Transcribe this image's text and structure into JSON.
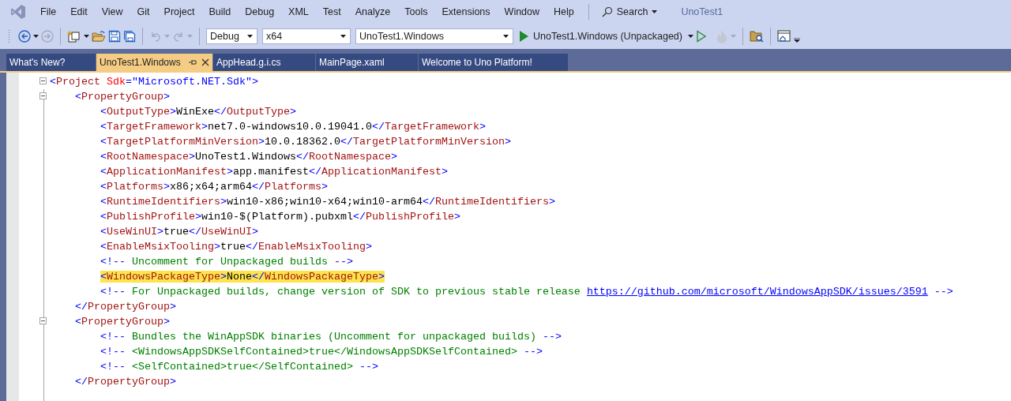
{
  "menu": {
    "items": [
      "File",
      "Edit",
      "View",
      "Git",
      "Project",
      "Build",
      "Debug",
      "XML",
      "Test",
      "Analyze",
      "Tools",
      "Extensions",
      "Window",
      "Help"
    ],
    "search": "Search",
    "solution_title": "UnoTest1"
  },
  "toolbar": {
    "configuration": "Debug",
    "platform": "x64",
    "startup_project": "UnoTest1.Windows",
    "run_target": "UnoTest1.Windows (Unpackaged)"
  },
  "tabs": [
    {
      "label": "What's New?",
      "selected": false
    },
    {
      "label": "UnoTest1.Windows",
      "selected": true
    },
    {
      "label": "AppHead.g.i.cs",
      "selected": false
    },
    {
      "label": "MainPage.xaml",
      "selected": false
    },
    {
      "label": "Welcome to Uno Platform!",
      "selected": false
    }
  ],
  "editor": {
    "lines": [
      {
        "highlighted": false,
        "tokens": [
          {
            "kind": "punct",
            "text": "<"
          },
          {
            "kind": "tag",
            "text": "Project"
          },
          {
            "kind": "attr",
            "text": " Sdk"
          },
          {
            "kind": "punct",
            "text": "="
          },
          {
            "kind": "value",
            "text": "\"Microsoft.NET.Sdk\""
          },
          {
            "kind": "punct",
            "text": ">"
          }
        ],
        "children": [
          {
            "highlighted": false,
            "tokens": [
              {
                "kind": "punct",
                "text": "<"
              },
              {
                "kind": "tag",
                "text": "PropertyGroup"
              },
              {
                "kind": "punct",
                "text": ">"
              }
            ],
            "children": [
              {
                "highlighted": false,
                "tokens": [
                  {
                    "kind": "punct",
                    "text": "<"
                  },
                  {
                    "kind": "tag",
                    "text": "OutputType"
                  },
                  {
                    "kind": "punct",
                    "text": ">"
                  },
                  {
                    "kind": "text",
                    "text": "WinExe"
                  },
                  {
                    "kind": "punct",
                    "text": "</"
                  },
                  {
                    "kind": "tag",
                    "text": "OutputType"
                  },
                  {
                    "kind": "punct",
                    "text": ">"
                  }
                ]
              },
              {
                "highlighted": false,
                "tokens": [
                  {
                    "kind": "punct",
                    "text": "<"
                  },
                  {
                    "kind": "tag",
                    "text": "TargetFramework"
                  },
                  {
                    "kind": "punct",
                    "text": ">"
                  },
                  {
                    "kind": "text",
                    "text": "net7.0-windows10.0.19041.0"
                  },
                  {
                    "kind": "punct",
                    "text": "</"
                  },
                  {
                    "kind": "tag",
                    "text": "TargetFramework"
                  },
                  {
                    "kind": "punct",
                    "text": ">"
                  }
                ]
              },
              {
                "highlighted": false,
                "tokens": [
                  {
                    "kind": "punct",
                    "text": "<"
                  },
                  {
                    "kind": "tag",
                    "text": "TargetPlatformMinVersion"
                  },
                  {
                    "kind": "punct",
                    "text": ">"
                  },
                  {
                    "kind": "text",
                    "text": "10.0.18362.0"
                  },
                  {
                    "kind": "punct",
                    "text": "</"
                  },
                  {
                    "kind": "tag",
                    "text": "TargetPlatformMinVersion"
                  },
                  {
                    "kind": "punct",
                    "text": ">"
                  }
                ]
              },
              {
                "highlighted": false,
                "tokens": [
                  {
                    "kind": "punct",
                    "text": "<"
                  },
                  {
                    "kind": "tag",
                    "text": "RootNamespace"
                  },
                  {
                    "kind": "punct",
                    "text": ">"
                  },
                  {
                    "kind": "text",
                    "text": "UnoTest1.Windows"
                  },
                  {
                    "kind": "punct",
                    "text": "</"
                  },
                  {
                    "kind": "tag",
                    "text": "RootNamespace"
                  },
                  {
                    "kind": "punct",
                    "text": ">"
                  }
                ]
              },
              {
                "highlighted": false,
                "tokens": [
                  {
                    "kind": "punct",
                    "text": "<"
                  },
                  {
                    "kind": "tag",
                    "text": "ApplicationManifest"
                  },
                  {
                    "kind": "punct",
                    "text": ">"
                  },
                  {
                    "kind": "text",
                    "text": "app.manifest"
                  },
                  {
                    "kind": "punct",
                    "text": "</"
                  },
                  {
                    "kind": "tag",
                    "text": "ApplicationManifest"
                  },
                  {
                    "kind": "punct",
                    "text": ">"
                  }
                ]
              },
              {
                "highlighted": false,
                "tokens": [
                  {
                    "kind": "punct",
                    "text": "<"
                  },
                  {
                    "kind": "tag",
                    "text": "Platforms"
                  },
                  {
                    "kind": "punct",
                    "text": ">"
                  },
                  {
                    "kind": "text",
                    "text": "x86;x64;arm64"
                  },
                  {
                    "kind": "punct",
                    "text": "</"
                  },
                  {
                    "kind": "tag",
                    "text": "Platforms"
                  },
                  {
                    "kind": "punct",
                    "text": ">"
                  }
                ]
              },
              {
                "highlighted": false,
                "tokens": [
                  {
                    "kind": "punct",
                    "text": "<"
                  },
                  {
                    "kind": "tag",
                    "text": "RuntimeIdentifiers"
                  },
                  {
                    "kind": "punct",
                    "text": ">"
                  },
                  {
                    "kind": "text",
                    "text": "win10-x86;win10-x64;win10-arm64"
                  },
                  {
                    "kind": "punct",
                    "text": "</"
                  },
                  {
                    "kind": "tag",
                    "text": "RuntimeIdentifiers"
                  },
                  {
                    "kind": "punct",
                    "text": ">"
                  }
                ]
              },
              {
                "highlighted": false,
                "tokens": [
                  {
                    "kind": "punct",
                    "text": "<"
                  },
                  {
                    "kind": "tag",
                    "text": "PublishProfile"
                  },
                  {
                    "kind": "punct",
                    "text": ">"
                  },
                  {
                    "kind": "text",
                    "text": "win10-$(Platform).pubxml"
                  },
                  {
                    "kind": "punct",
                    "text": "</"
                  },
                  {
                    "kind": "tag",
                    "text": "PublishProfile"
                  },
                  {
                    "kind": "punct",
                    "text": ">"
                  }
                ]
              },
              {
                "highlighted": false,
                "tokens": [
                  {
                    "kind": "punct",
                    "text": "<"
                  },
                  {
                    "kind": "tag",
                    "text": "UseWinUI"
                  },
                  {
                    "kind": "punct",
                    "text": ">"
                  },
                  {
                    "kind": "text",
                    "text": "true"
                  },
                  {
                    "kind": "punct",
                    "text": "</"
                  },
                  {
                    "kind": "tag",
                    "text": "UseWinUI"
                  },
                  {
                    "kind": "punct",
                    "text": ">"
                  }
                ]
              },
              {
                "highlighted": false,
                "tokens": [
                  {
                    "kind": "punct",
                    "text": "<"
                  },
                  {
                    "kind": "tag",
                    "text": "EnableMsixTooling"
                  },
                  {
                    "kind": "punct",
                    "text": ">"
                  },
                  {
                    "kind": "text",
                    "text": "true"
                  },
                  {
                    "kind": "punct",
                    "text": "</"
                  },
                  {
                    "kind": "tag",
                    "text": "EnableMsixTooling"
                  },
                  {
                    "kind": "punct",
                    "text": ">"
                  }
                ]
              },
              {
                "highlighted": false,
                "tokens": [
                  {
                    "kind": "punct",
                    "text": "<!--"
                  },
                  {
                    "kind": "comment",
                    "text": " Uncomment for Unpackaged builds "
                  },
                  {
                    "kind": "punct",
                    "text": "-->"
                  }
                ]
              },
              {
                "highlighted": true,
                "tokens": [
                  {
                    "kind": "punct",
                    "text": "<"
                  },
                  {
                    "kind": "tag",
                    "text": "WindowsPackageType"
                  },
                  {
                    "kind": "punct",
                    "text": ">"
                  },
                  {
                    "kind": "text",
                    "text": "None"
                  },
                  {
                    "kind": "punct",
                    "text": "</"
                  },
                  {
                    "kind": "tag",
                    "text": "WindowsPackageType"
                  },
                  {
                    "kind": "punct",
                    "text": ">"
                  }
                ]
              },
              {
                "highlighted": false,
                "tokens": [
                  {
                    "kind": "punct",
                    "text": "<!--"
                  },
                  {
                    "kind": "comment",
                    "text": " For Unpackaged builds, change version of SDK to previous stable release "
                  },
                  {
                    "kind": "link",
                    "text": "https://github.com/microsoft/WindowsAppSDK/issues/3591"
                  },
                  {
                    "kind": "punct",
                    "text": " -->"
                  }
                ]
              }
            ]
          },
          {
            "highlighted": false,
            "tokens": [
              {
                "kind": "punct",
                "text": "</"
              },
              {
                "kind": "tag",
                "text": "PropertyGroup"
              },
              {
                "kind": "punct",
                "text": ">"
              }
            ]
          },
          {
            "highlighted": false,
            "tokens": [
              {
                "kind": "punct",
                "text": "<"
              },
              {
                "kind": "tag",
                "text": "PropertyGroup"
              },
              {
                "kind": "punct",
                "text": ">"
              }
            ],
            "children": [
              {
                "highlighted": false,
                "tokens": [
                  {
                    "kind": "punct",
                    "text": "<!--"
                  },
                  {
                    "kind": "comment",
                    "text": " Bundles the WinAppSDK binaries (Uncomment for unpackaged builds) "
                  },
                  {
                    "kind": "punct",
                    "text": "-->"
                  }
                ]
              },
              {
                "highlighted": false,
                "tokens": [
                  {
                    "kind": "punct",
                    "text": "<!--"
                  },
                  {
                    "kind": "comment",
                    "text": " <WindowsAppSDKSelfContained>true</WindowsAppSDKSelfContained> "
                  },
                  {
                    "kind": "punct",
                    "text": "-->"
                  }
                ]
              },
              {
                "highlighted": false,
                "tokens": [
                  {
                    "kind": "punct",
                    "text": "<!--"
                  },
                  {
                    "kind": "comment",
                    "text": " <SelfContained>true</SelfContained> "
                  },
                  {
                    "kind": "punct",
                    "text": "-->"
                  }
                ]
              }
            ]
          },
          {
            "highlighted": false,
            "tokens": [
              {
                "kind": "punct",
                "text": "</"
              },
              {
                "kind": "tag",
                "text": "PropertyGroup"
              },
              {
                "kind": "punct",
                "text": ">"
              }
            ]
          }
        ]
      }
    ]
  }
}
